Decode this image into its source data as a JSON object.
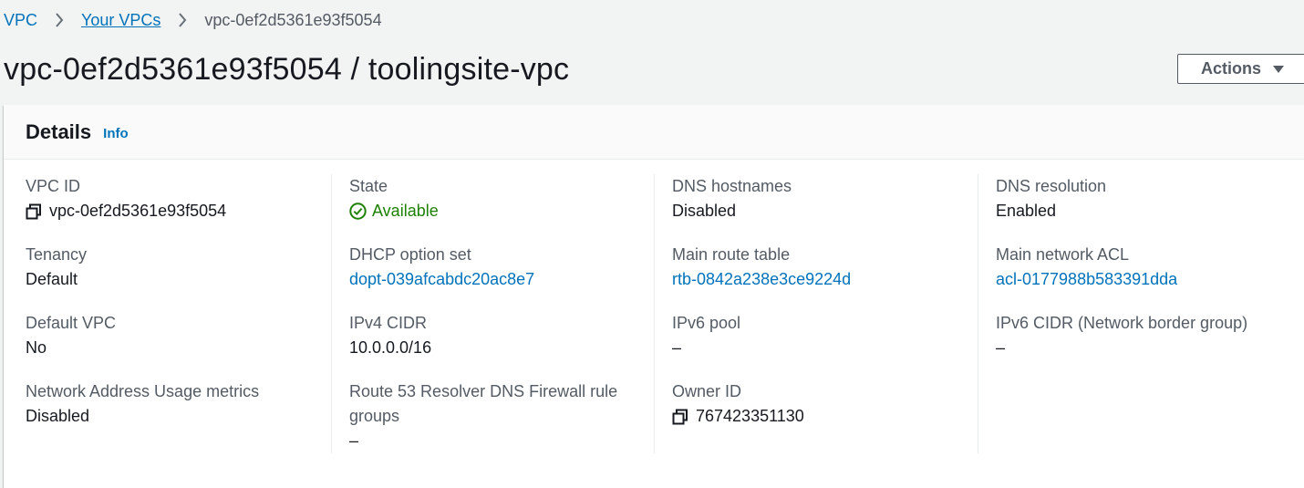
{
  "breadcrumb": {
    "items": [
      "VPC",
      "Your VPCs"
    ],
    "current": "vpc-0ef2d5361e93f5054"
  },
  "page": {
    "title": "vpc-0ef2d5361e93f5054 / toolingsite-vpc",
    "actions_label": "Actions"
  },
  "details": {
    "title": "Details",
    "info_label": "Info",
    "columns": [
      [
        {
          "label": "VPC ID",
          "value": "vpc-0ef2d5361e93f5054",
          "kind": "copy"
        },
        {
          "label": "Tenancy",
          "value": "Default"
        },
        {
          "label": "Default VPC",
          "value": "No"
        },
        {
          "label": "Network Address Usage metrics",
          "value": "Disabled"
        }
      ],
      [
        {
          "label": "State",
          "value": "Available",
          "kind": "status"
        },
        {
          "label": "DHCP option set",
          "value": "dopt-039afcabdc20ac8e7",
          "kind": "link"
        },
        {
          "label": "IPv4 CIDR",
          "value": "10.0.0.0/16"
        },
        {
          "label": "Route 53 Resolver DNS Firewall rule groups",
          "value": "–"
        }
      ],
      [
        {
          "label": "DNS hostnames",
          "value": "Disabled"
        },
        {
          "label": "Main route table",
          "value": "rtb-0842a238e3ce9224d",
          "kind": "link"
        },
        {
          "label": "IPv6 pool",
          "value": "–"
        },
        {
          "label": "Owner ID",
          "value": "767423351130",
          "kind": "copy"
        }
      ],
      [
        {
          "label": "DNS resolution",
          "value": "Enabled"
        },
        {
          "label": "Main network ACL",
          "value": "acl-0177988b583391dda",
          "kind": "link"
        },
        {
          "label": "IPv6 CIDR (Network border group)",
          "value": "–"
        }
      ]
    ]
  },
  "icons": {
    "breadcrumb_separator": "chevron-right-icon",
    "actions_caret": "caret-down-icon",
    "copy": "copy-icon",
    "status": "check-circle-icon"
  },
  "colors": {
    "link": "#0073bb",
    "success": "#1d8102",
    "background": "#f2f3f3"
  }
}
